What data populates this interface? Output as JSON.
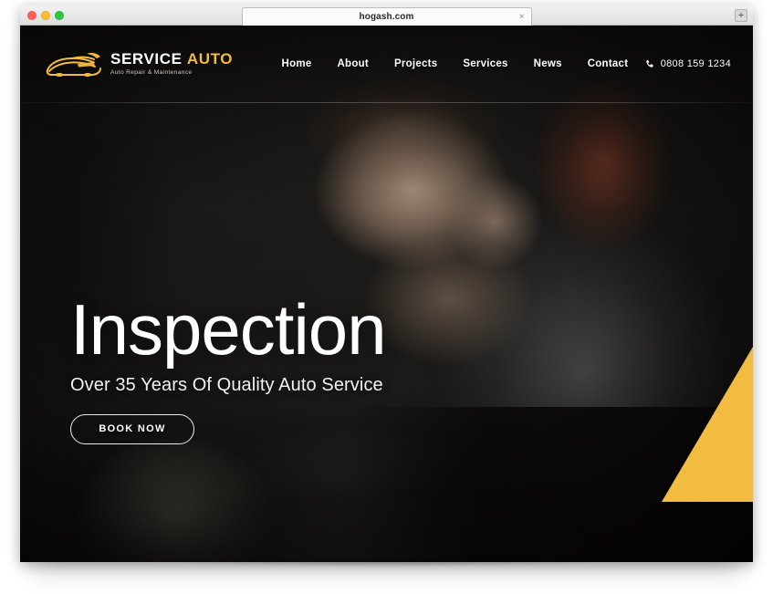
{
  "browser": {
    "traffic_lights": [
      "close",
      "minimize",
      "zoom"
    ],
    "tab_title": "hogash.com",
    "tab_close_label": "×",
    "new_tab_label": "+"
  },
  "site": {
    "logo": {
      "icon": "sports-car-icon",
      "word_primary": "SERVICE",
      "word_accent": "AUTO",
      "tagline": "Auto Repair & Maintenance"
    },
    "nav": [
      {
        "label": "Home"
      },
      {
        "label": "About"
      },
      {
        "label": "Projects"
      },
      {
        "label": "Services"
      },
      {
        "label": "News"
      },
      {
        "label": "Contact"
      }
    ],
    "phone": {
      "icon": "phone-icon",
      "number": "0808 159 1234"
    }
  },
  "hero": {
    "title": "Inspection",
    "subtitle": "Over 35 Years Of Quality Auto Service",
    "cta_label": "BOOK NOW",
    "background_alt": "mechanic-inspecting-engine-photo"
  },
  "colors": {
    "accent": "#f2bc41",
    "text_on_dark": "#ffffff",
    "hero_backdrop": "#14110f",
    "chrome": "#e8e8e8"
  }
}
